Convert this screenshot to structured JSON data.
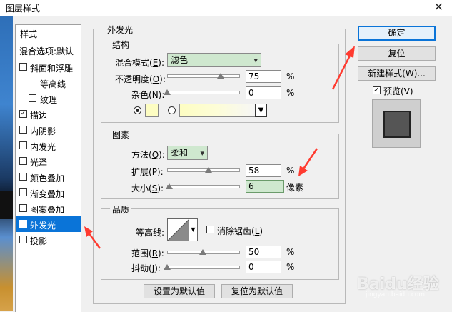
{
  "window": {
    "title": "图层样式",
    "close_glyph": "✕"
  },
  "sidebar": {
    "header": "样式",
    "blend_options": "混合选项:默认",
    "items": [
      {
        "label": "斜面和浮雕",
        "checked": false,
        "indent": false,
        "active": false
      },
      {
        "label": "等高线",
        "checked": false,
        "indent": true,
        "active": false
      },
      {
        "label": "纹理",
        "checked": false,
        "indent": true,
        "active": false
      },
      {
        "label": "描边",
        "checked": true,
        "indent": false,
        "active": false
      },
      {
        "label": "内阴影",
        "checked": false,
        "indent": false,
        "active": false
      },
      {
        "label": "内发光",
        "checked": false,
        "indent": false,
        "active": false
      },
      {
        "label": "光泽",
        "checked": false,
        "indent": false,
        "active": false
      },
      {
        "label": "颜色叠加",
        "checked": false,
        "indent": false,
        "active": false
      },
      {
        "label": "渐变叠加",
        "checked": false,
        "indent": false,
        "active": false
      },
      {
        "label": "图案叠加",
        "checked": false,
        "indent": false,
        "active": false
      },
      {
        "label": "外发光",
        "checked": true,
        "indent": false,
        "active": true
      },
      {
        "label": "投影",
        "checked": false,
        "indent": false,
        "active": false
      }
    ]
  },
  "panel": {
    "title": "外发光",
    "structure": {
      "legend": "结构",
      "blend_mode_label": "混合模式(",
      "blend_mode_key": "E",
      "blend_mode_value": "滤色",
      "opacity_label": "不透明度(",
      "opacity_key": "O",
      "opacity_value": "75",
      "opacity_fraction": 0.75,
      "noise_label": "杂色(",
      "noise_key": "N",
      "noise_value": "0",
      "noise_fraction": 0,
      "percent": "%",
      "color_swatch": "#fdfdc2"
    },
    "elements": {
      "legend": "图素",
      "method_label": "方法(",
      "method_key": "Q",
      "method_value": "柔和",
      "spread_label": "扩展(",
      "spread_key": "P",
      "spread_value": "58",
      "spread_fraction": 0.58,
      "size_label": "大小(",
      "size_key": "S",
      "size_value": "6",
      "size_fraction": 0.03,
      "size_unit": "像素",
      "percent": "%"
    },
    "quality": {
      "legend": "品质",
      "contour_label": "等高线:",
      "antialias_label": "消除锯齿(",
      "antialias_key": "L",
      "range_label": "范围(",
      "range_key": "R",
      "range_value": "50",
      "range_fraction": 0.5,
      "jitter_label": "抖动(",
      "jitter_key": "J",
      "jitter_value": "0",
      "jitter_fraction": 0,
      "percent": "%"
    },
    "set_default_button": "设置为默认值",
    "reset_default_button": "复位为默认值"
  },
  "right": {
    "ok_button": "确定",
    "reset_button": "复位",
    "new_style_button": "新建样式(W)...",
    "preview_label": "预览(V)",
    "preview_checked": true
  },
  "watermark": "Baidu经验",
  "watermark_sub": "jingyan.baidu.com",
  "colors": {
    "accent": "#0a74d8",
    "annotation": "#ff3b30",
    "select_bg": "#cfe8cf"
  }
}
